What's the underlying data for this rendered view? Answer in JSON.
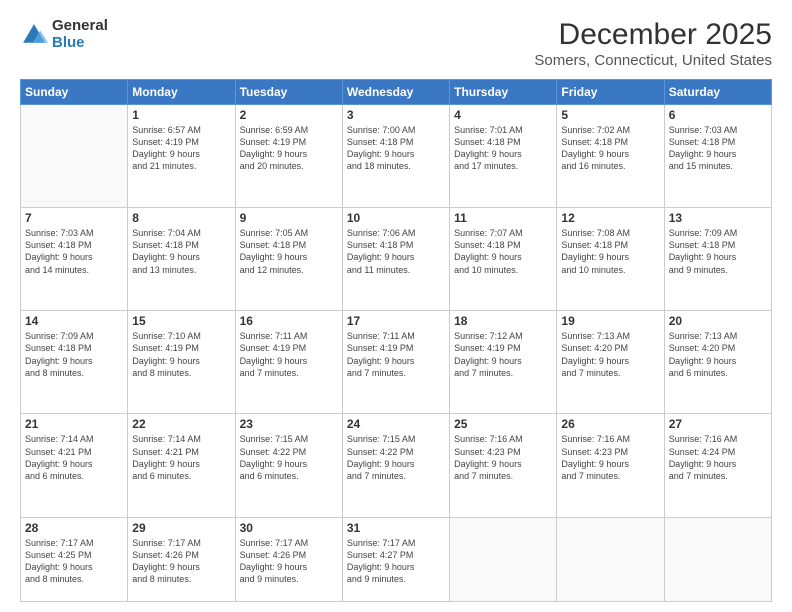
{
  "header": {
    "logo_general": "General",
    "logo_blue": "Blue",
    "title": "December 2025",
    "subtitle": "Somers, Connecticut, United States"
  },
  "days_of_week": [
    "Sunday",
    "Monday",
    "Tuesday",
    "Wednesday",
    "Thursday",
    "Friday",
    "Saturday"
  ],
  "weeks": [
    [
      {
        "day": "",
        "text": ""
      },
      {
        "day": "1",
        "text": "Sunrise: 6:57 AM\nSunset: 4:19 PM\nDaylight: 9 hours\nand 21 minutes."
      },
      {
        "day": "2",
        "text": "Sunrise: 6:59 AM\nSunset: 4:19 PM\nDaylight: 9 hours\nand 20 minutes."
      },
      {
        "day": "3",
        "text": "Sunrise: 7:00 AM\nSunset: 4:18 PM\nDaylight: 9 hours\nand 18 minutes."
      },
      {
        "day": "4",
        "text": "Sunrise: 7:01 AM\nSunset: 4:18 PM\nDaylight: 9 hours\nand 17 minutes."
      },
      {
        "day": "5",
        "text": "Sunrise: 7:02 AM\nSunset: 4:18 PM\nDaylight: 9 hours\nand 16 minutes."
      },
      {
        "day": "6",
        "text": "Sunrise: 7:03 AM\nSunset: 4:18 PM\nDaylight: 9 hours\nand 15 minutes."
      }
    ],
    [
      {
        "day": "7",
        "text": "Sunrise: 7:03 AM\nSunset: 4:18 PM\nDaylight: 9 hours\nand 14 minutes."
      },
      {
        "day": "8",
        "text": "Sunrise: 7:04 AM\nSunset: 4:18 PM\nDaylight: 9 hours\nand 13 minutes."
      },
      {
        "day": "9",
        "text": "Sunrise: 7:05 AM\nSunset: 4:18 PM\nDaylight: 9 hours\nand 12 minutes."
      },
      {
        "day": "10",
        "text": "Sunrise: 7:06 AM\nSunset: 4:18 PM\nDaylight: 9 hours\nand 11 minutes."
      },
      {
        "day": "11",
        "text": "Sunrise: 7:07 AM\nSunset: 4:18 PM\nDaylight: 9 hours\nand 10 minutes."
      },
      {
        "day": "12",
        "text": "Sunrise: 7:08 AM\nSunset: 4:18 PM\nDaylight: 9 hours\nand 10 minutes."
      },
      {
        "day": "13",
        "text": "Sunrise: 7:09 AM\nSunset: 4:18 PM\nDaylight: 9 hours\nand 9 minutes."
      }
    ],
    [
      {
        "day": "14",
        "text": "Sunrise: 7:09 AM\nSunset: 4:18 PM\nDaylight: 9 hours\nand 8 minutes."
      },
      {
        "day": "15",
        "text": "Sunrise: 7:10 AM\nSunset: 4:19 PM\nDaylight: 9 hours\nand 8 minutes."
      },
      {
        "day": "16",
        "text": "Sunrise: 7:11 AM\nSunset: 4:19 PM\nDaylight: 9 hours\nand 7 minutes."
      },
      {
        "day": "17",
        "text": "Sunrise: 7:11 AM\nSunset: 4:19 PM\nDaylight: 9 hours\nand 7 minutes."
      },
      {
        "day": "18",
        "text": "Sunrise: 7:12 AM\nSunset: 4:19 PM\nDaylight: 9 hours\nand 7 minutes."
      },
      {
        "day": "19",
        "text": "Sunrise: 7:13 AM\nSunset: 4:20 PM\nDaylight: 9 hours\nand 7 minutes."
      },
      {
        "day": "20",
        "text": "Sunrise: 7:13 AM\nSunset: 4:20 PM\nDaylight: 9 hours\nand 6 minutes."
      }
    ],
    [
      {
        "day": "21",
        "text": "Sunrise: 7:14 AM\nSunset: 4:21 PM\nDaylight: 9 hours\nand 6 minutes."
      },
      {
        "day": "22",
        "text": "Sunrise: 7:14 AM\nSunset: 4:21 PM\nDaylight: 9 hours\nand 6 minutes."
      },
      {
        "day": "23",
        "text": "Sunrise: 7:15 AM\nSunset: 4:22 PM\nDaylight: 9 hours\nand 6 minutes."
      },
      {
        "day": "24",
        "text": "Sunrise: 7:15 AM\nSunset: 4:22 PM\nDaylight: 9 hours\nand 7 minutes."
      },
      {
        "day": "25",
        "text": "Sunrise: 7:16 AM\nSunset: 4:23 PM\nDaylight: 9 hours\nand 7 minutes."
      },
      {
        "day": "26",
        "text": "Sunrise: 7:16 AM\nSunset: 4:23 PM\nDaylight: 9 hours\nand 7 minutes."
      },
      {
        "day": "27",
        "text": "Sunrise: 7:16 AM\nSunset: 4:24 PM\nDaylight: 9 hours\nand 7 minutes."
      }
    ],
    [
      {
        "day": "28",
        "text": "Sunrise: 7:17 AM\nSunset: 4:25 PM\nDaylight: 9 hours\nand 8 minutes."
      },
      {
        "day": "29",
        "text": "Sunrise: 7:17 AM\nSunset: 4:26 PM\nDaylight: 9 hours\nand 8 minutes."
      },
      {
        "day": "30",
        "text": "Sunrise: 7:17 AM\nSunset: 4:26 PM\nDaylight: 9 hours\nand 9 minutes."
      },
      {
        "day": "31",
        "text": "Sunrise: 7:17 AM\nSunset: 4:27 PM\nDaylight: 9 hours\nand 9 minutes."
      },
      {
        "day": "",
        "text": ""
      },
      {
        "day": "",
        "text": ""
      },
      {
        "day": "",
        "text": ""
      }
    ]
  ]
}
